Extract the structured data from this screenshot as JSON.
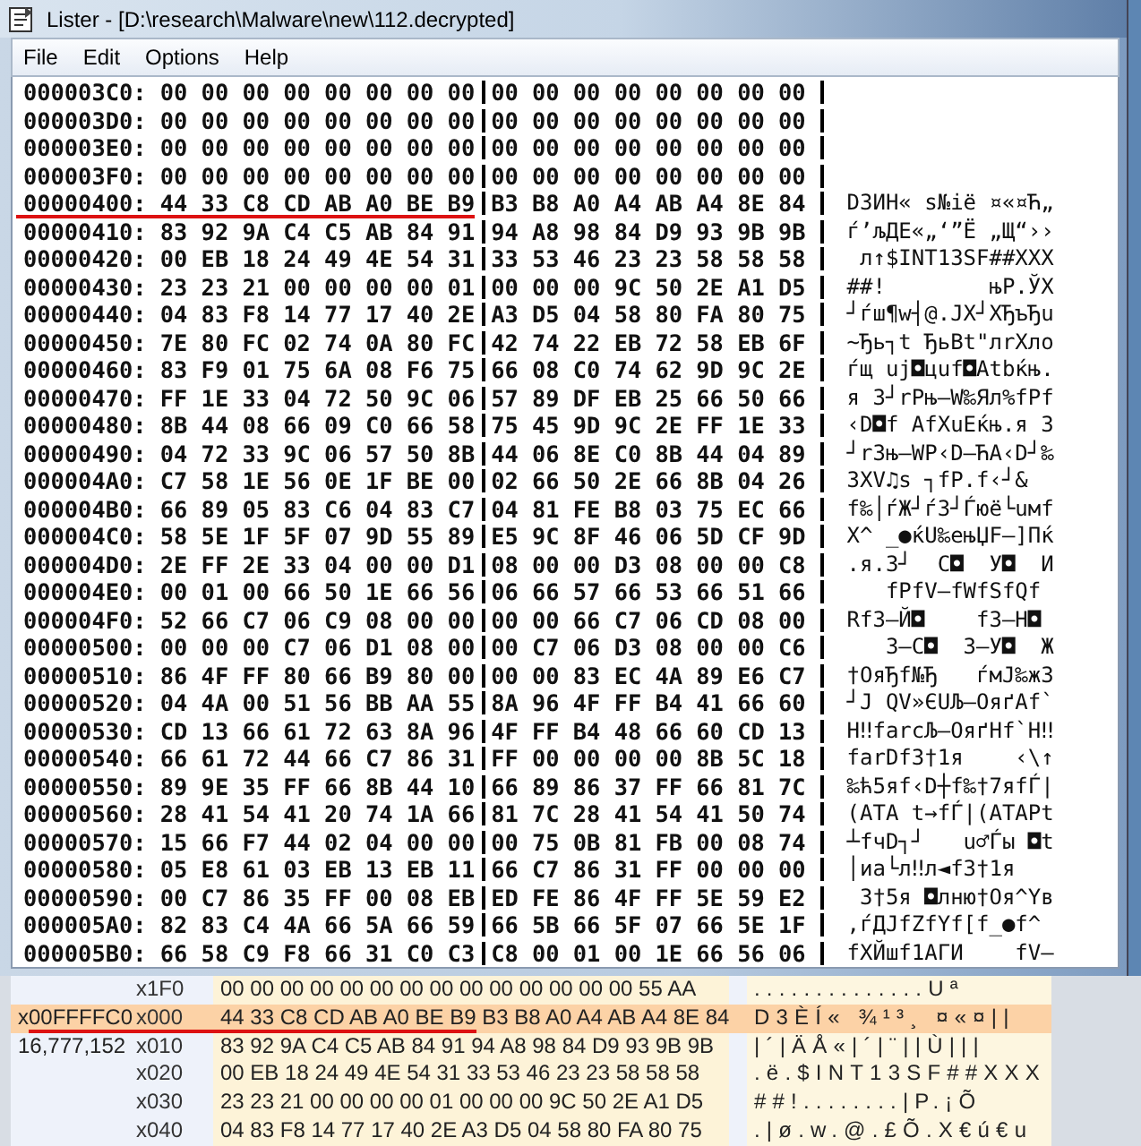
{
  "window": {
    "title": "Lister - [D:\\research\\Malware\\new\\112.decrypted]"
  },
  "menu": [
    "File",
    "Edit",
    "Options",
    "Help"
  ],
  "dump": {
    "rows": [
      {
        "offset": "000003C0:",
        "hex_left": "00 00 00 00 00 00 00 00",
        "hex_right": "00 00 00 00 00 00 00 00",
        "underlined": false
      },
      {
        "offset": "000003D0:",
        "hex_left": "00 00 00 00 00 00 00 00",
        "hex_right": "00 00 00 00 00 00 00 00",
        "underlined": false
      },
      {
        "offset": "000003E0:",
        "hex_left": "00 00 00 00 00 00 00 00",
        "hex_right": "00 00 00 00 00 00 00 00",
        "underlined": false
      },
      {
        "offset": "000003F0:",
        "hex_left": "00 00 00 00 00 00 00 00",
        "hex_right": "00 00 00 00 00 00 00 00",
        "underlined": false
      },
      {
        "offset": "00000400:",
        "hex_left": "44 33 C8 CD AB A0 BE B9",
        "hex_right": "B3 B8 A0 A4 AB A4 8E 84",
        "ascii": "D3ИН« ѕ№іё ¤«¤Ћ„",
        "underlined": true
      },
      {
        "offset": "00000410:",
        "hex_left": "83 92 9A C4 C5 AB 84 91",
        "hex_right": "94 A8 98 84 D9 93 9B 9B",
        "ascii": "ѓ’љДЕ«„‘”Ё „Щ“››",
        "underlined": false
      },
      {
        "offset": "00000420:",
        "hex_left": "00 EB 18 24 49 4E 54 31",
        "hex_right": "33 53 46 23 23 58 58 58",
        "ascii": " л↑$INT13SF##XXX",
        "underlined": false
      },
      {
        "offset": "00000430:",
        "hex_left": "23 23 21 00 00 00 00 01",
        "hex_right": "00 00 00 9C 50 2E A1 D5",
        "ascii": "##!        њP.ЎХ",
        "underlined": false
      },
      {
        "offset": "00000440:",
        "hex_left": "04 83 F8 14 77 17 40 2E",
        "hex_right": "A3 D5 04 58 80 FA 80 75",
        "ascii": "┘ѓш¶w┤@.ЈХ┘XЂъЂu",
        "underlined": false
      },
      {
        "offset": "00000450:",
        "hex_left": "7E 80 FC 02 74 0A 80 FC",
        "hex_right": "42 74 22 EB 72 58 EB 6F",
        "ascii": "~Ђь┐t ЂьBt\"лrXлo",
        "underlined": false
      },
      {
        "offset": "00000460:",
        "hex_left": "83 F9 01 75 6A 08 F6 75",
        "hex_right": "66 08 C0 74 62 9D 9C 2E",
        "ascii": "ѓщ uj◘цuf◘Аtbќњ.",
        "underlined": false
      },
      {
        "offset": "00000470:",
        "hex_left": "FF 1E 33 04 72 50 9C 06",
        "hex_right": "57 89 DF EB 25 66 50 66",
        "ascii": "я 3┘rPњ—W‰Ял%fPf",
        "underlined": false
      },
      {
        "offset": "00000480:",
        "hex_left": "8B 44 08 66 09 C0 66 58",
        "hex_right": "75 45 9D 9C 2E FF 1E 33",
        "ascii": "‹D◘f АfXuEќњ.я 3",
        "underlined": false
      },
      {
        "offset": "00000490:",
        "hex_left": "04 72 33 9C 06 57 50 8B",
        "hex_right": "44 06 8E C0 8B 44 04 89",
        "ascii": "┘r3њ—WP‹D—ЋА‹D┘‰",
        "underlined": false
      },
      {
        "offset": "000004A0:",
        "hex_left": "C7 58 1E 56 0E 1F BE 00",
        "hex_right": "02 66 50 2E 66 8B 04 26",
        "ascii": "ЗXV♫ѕ ┐fP.f‹┘&",
        "underlined": false
      },
      {
        "offset": "000004B0:",
        "hex_left": "66 89 05 83 C6 04 83 C7",
        "hex_right": "04 81 FE B8 03 75 EC 66",
        "ascii": "f‰│ѓЖ┘ѓЗ┘Ѓюё└uмf",
        "underlined": false
      },
      {
        "offset": "000004C0:",
        "hex_left": "58 5E 1F 5F 07 9D 55 89",
        "hex_right": "E5 9C 8F 46 06 5D CF 9D",
        "ascii": "X^ _●ќU‰ењЏF—]Пќ",
        "underlined": false
      },
      {
        "offset": "000004D0:",
        "hex_left": "2E FF 2E 33 04 00 00 D1",
        "hex_right": "08 00 00 D3 08 00 00 C8",
        "ascii": ".я.3┘  С◘  У◘  И",
        "underlined": false
      },
      {
        "offset": "000004E0:",
        "hex_left": "00 01 00 66 50 1E 66 56",
        "hex_right": "06 66 57 66 53 66 51 66",
        "ascii": "   fPfV—fWfSfQf",
        "underlined": false
      },
      {
        "offset": "000004F0:",
        "hex_left": "52 66 C7 06 C9 08 00 00",
        "hex_right": "00 00 66 C7 06 CD 08 00",
        "ascii": "RfЗ—Й◘    fЗ—Н◘",
        "underlined": false
      },
      {
        "offset": "00000500:",
        "hex_left": "00 00 00 C7 06 D1 08 00",
        "hex_right": "00 C7 06 D3 08 00 00 C6",
        "ascii": "   З—С◘  З—У◘  Ж",
        "underlined": false
      },
      {
        "offset": "00000510:",
        "hex_left": "86 4F FF 80 66 B9 80 00",
        "hex_right": "00 00 83 EC 4A 89 E6 C7",
        "ascii": "†OяЂf№Ђ   ѓмJ‰жЗ",
        "underlined": false
      },
      {
        "offset": "00000520:",
        "hex_left": "04 4A 00 51 56 BB AA 55",
        "hex_right": "8A 96 4F FF B4 41 66 60",
        "ascii": "┘J QV»ЄUЉ–OяґAf`",
        "underlined": false
      },
      {
        "offset": "00000530:",
        "hex_left": "CD 13 66 61 72 63 8A 96",
        "hex_right": "4F FF B4 48 66 60 CD 13",
        "ascii": "Н‼farcЉ–OяґHf`Н‼",
        "underlined": false
      },
      {
        "offset": "00000540:",
        "hex_left": "66 61 72 44 66 C7 86 31",
        "hex_right": "FF 00 00 00 00 8B 5C 18",
        "ascii": "farDfЗ†1я    ‹\\↑",
        "underlined": false
      },
      {
        "offset": "00000550:",
        "hex_left": "89 9E 35 FF 66 8B 44 10",
        "hex_right": "66 89 86 37 FF 66 81 7C",
        "ascii": "‰ћ5яf‹D┼f‰†7яfЃ|",
        "underlined": false
      },
      {
        "offset": "00000560:",
        "hex_left": "28 41 54 41 20 74 1A 66",
        "hex_right": "81 7C 28 41 54 41 50 74",
        "ascii": "(ATA t→fЃ|(ATAPt",
        "underlined": false
      },
      {
        "offset": "00000570:",
        "hex_left": "15 66 F7 44 02 04 00 00",
        "hex_right": "00 75 0B 81 FB 00 08 74",
        "ascii": "┴fчD┐┘   u♂Ѓы ◘t",
        "underlined": false
      },
      {
        "offset": "00000580:",
        "hex_left": "05 E8 61 03 EB 13 EB 11",
        "hex_right": "66 C7 86 31 FF 00 00 00",
        "ascii": "│иa└л‼л◄fЗ†1я",
        "underlined": false
      },
      {
        "offset": "00000590:",
        "hex_left": "00 C7 86 35 FF 00 08 EB",
        "hex_right": "ED FE 86 4F FF 5E 59 E2",
        "ascii": " З†5я ◘лню†Oя^Yв",
        "underlined": false
      },
      {
        "offset": "000005A0:",
        "hex_left": "82 83 C4 4A 66 5A 66 59",
        "hex_right": "66 5B 66 5F 07 66 5E 1F",
        "ascii": "‚ѓДJfZfYf[f_●f^",
        "underlined": false
      },
      {
        "offset": "000005B0:",
        "hex_left": "66 58 C9 F8 66 31 C0 C3",
        "hex_right": "C8 00 01 00 1E 66 56 06",
        "ascii": "fXЙшf1АГИ    fV—",
        "underlined": false
      }
    ]
  },
  "second_viewer": {
    "rows": [
      {
        "offset": "x1F0",
        "hex": "00 00 00 00 00 00 00 00 00 00 00 00 00 00 55 AA",
        "ascii": "..............Uª",
        "selected": false,
        "underlined": false
      },
      {
        "label": "x00FFFFC0",
        "offset": "x000",
        "hex": "44 33 C8 CD AB A0 BE B9 B3 B8 A0 A4 AB A4 8E 84",
        "ascii": "D3ÈÍ« ¾¹³¸ ¤«¤||",
        "selected": true,
        "underlined": true
      },
      {
        "label": "16,777,152",
        "offset": "x010",
        "hex": "83 92 9A C4 C5 AB 84 91 94 A8 98 84 D9 93 9B 9B",
        "ascii": "|´|ÄÅ«|´|¨||Ù|||",
        "selected": false,
        "underlined": false
      },
      {
        "offset": "x020",
        "hex": "00 EB 18 24 49 4E 54 31 33 53 46 23 23 58 58 58",
        "ascii": ".ë.$INT13SF##XXX",
        "selected": false,
        "underlined": false
      },
      {
        "offset": "x030",
        "hex": "23 23 21 00 00 00 00 01 00 00 00 9C 50 2E A1 D5",
        "ascii": "##!........|P.¡Õ",
        "selected": false,
        "underlined": false
      },
      {
        "offset": "x040",
        "hex": "04 83 F8 14 77 17 40 2E A3 D5 04 58 80 FA 80 75",
        "ascii": ".|ø.w.@.£Õ.X€ú€u",
        "selected": false,
        "underlined": false
      }
    ]
  }
}
